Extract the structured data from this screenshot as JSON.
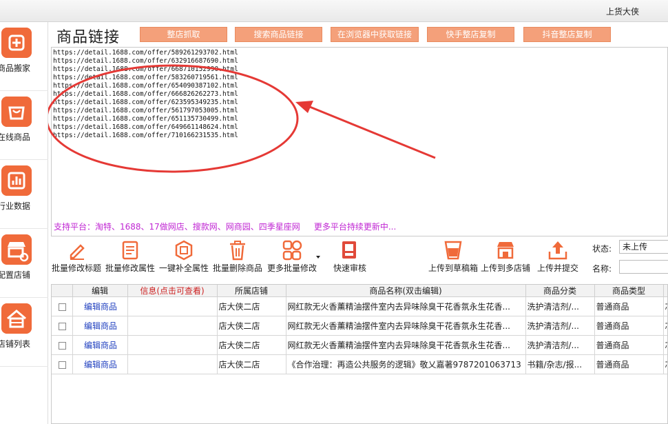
{
  "app": {
    "name": "上货大侠"
  },
  "sidebar": {
    "items": [
      {
        "label": "商品搬家"
      },
      {
        "label": "在线商品"
      },
      {
        "label": "行业数据"
      },
      {
        "label": "配置店铺"
      },
      {
        "label": "店铺列表"
      }
    ]
  },
  "header": {
    "title": "商品链接",
    "buttons": [
      "整店抓取",
      "搜索商品链接",
      "在浏览器中获取链接",
      "快手整店复制",
      "抖音整店复制"
    ]
  },
  "links": [
    "https://detail.1688.com/offer/589261293702.html",
    "https://detail.1688.com/offer/632916687690.html",
    "https://detail.1688.com/offer/668710152990.html",
    "https://detail.1688.com/offer/583260719561.html",
    "https://detail.1688.com/offer/654090387102.html",
    "https://detail.1688.com/offer/666826262273.html",
    "https://detail.1688.com/offer/623595349235.html",
    "https://detail.1688.com/offer/561797053005.html",
    "https://detail.1688.com/offer/651135730499.html",
    "https://detail.1688.com/offer/649661148624.html",
    "https://detail.1688.com/offer/710166231535.html"
  ],
  "platforms": {
    "text": "支持平台：淘特、1688、17做网店、搜款网、网商园、四季星座网",
    "more": "更多平台持续更新中..."
  },
  "toolbar": {
    "items": [
      {
        "label": "批量修改标题",
        "icon": "pencil-icon"
      },
      {
        "label": "批量修改属性",
        "icon": "properties-icon"
      },
      {
        "label": "一键补全属性",
        "icon": "complete-icon"
      },
      {
        "label": "批量删除商品",
        "icon": "trash-icon"
      },
      {
        "label": "更多批量修改",
        "icon": "grid-icon"
      },
      {
        "label": "快速审核",
        "icon": "review-icon"
      },
      {
        "label": "上传到草稿箱",
        "icon": "cup-icon"
      },
      {
        "label": "上传到多店铺",
        "icon": "stores-icon"
      },
      {
        "label": "上传并提交",
        "icon": "upload-icon"
      }
    ]
  },
  "filters": {
    "state_label": "状态:",
    "state_value": "未上传",
    "name_label": "名称:"
  },
  "table": {
    "headers": [
      "",
      "编辑",
      "信息(点击可查看)",
      "所属店铺",
      "商品名称(双击编辑)",
      "商品分类",
      "商品类型",
      ""
    ],
    "rows": [
      {
        "edit": "编辑商品",
        "info": "",
        "store": "店大侠二店",
        "name": "网红款无火香薰精油摆件室内去异味除臭干花香氛永生花香...",
        "category": "洗护清洁剂/...",
        "type": "普通商品",
        "extra": "芯"
      },
      {
        "edit": "编辑商品",
        "info": "",
        "store": "店大侠二店",
        "name": "网红款无火香薰精油摆件室内去异味除臭干花香氛永生花香...",
        "category": "洗护清洁剂/...",
        "type": "普通商品",
        "extra": "芯"
      },
      {
        "edit": "编辑商品",
        "info": "",
        "store": "店大侠二店",
        "name": "网红款无火香薰精油摆件室内去异味除臭干花香氛永生花香...",
        "category": "洗护清洁剂/...",
        "type": "普通商品",
        "extra": "芯"
      },
      {
        "edit": "编辑商品",
        "info": "",
        "store": "店大侠二店",
        "name": "《合作治理：再造公共服务的逻辑》敬乂嘉著9787201063713",
        "category": "书籍/杂志/报...",
        "type": "普通商品",
        "extra": "芯"
      }
    ]
  },
  "colors": {
    "accent": "#f06a3a",
    "button": "#f4a07a",
    "platform_text": "#c026d3",
    "annotation": "#e53935",
    "edit_link": "#1f3fbf"
  }
}
